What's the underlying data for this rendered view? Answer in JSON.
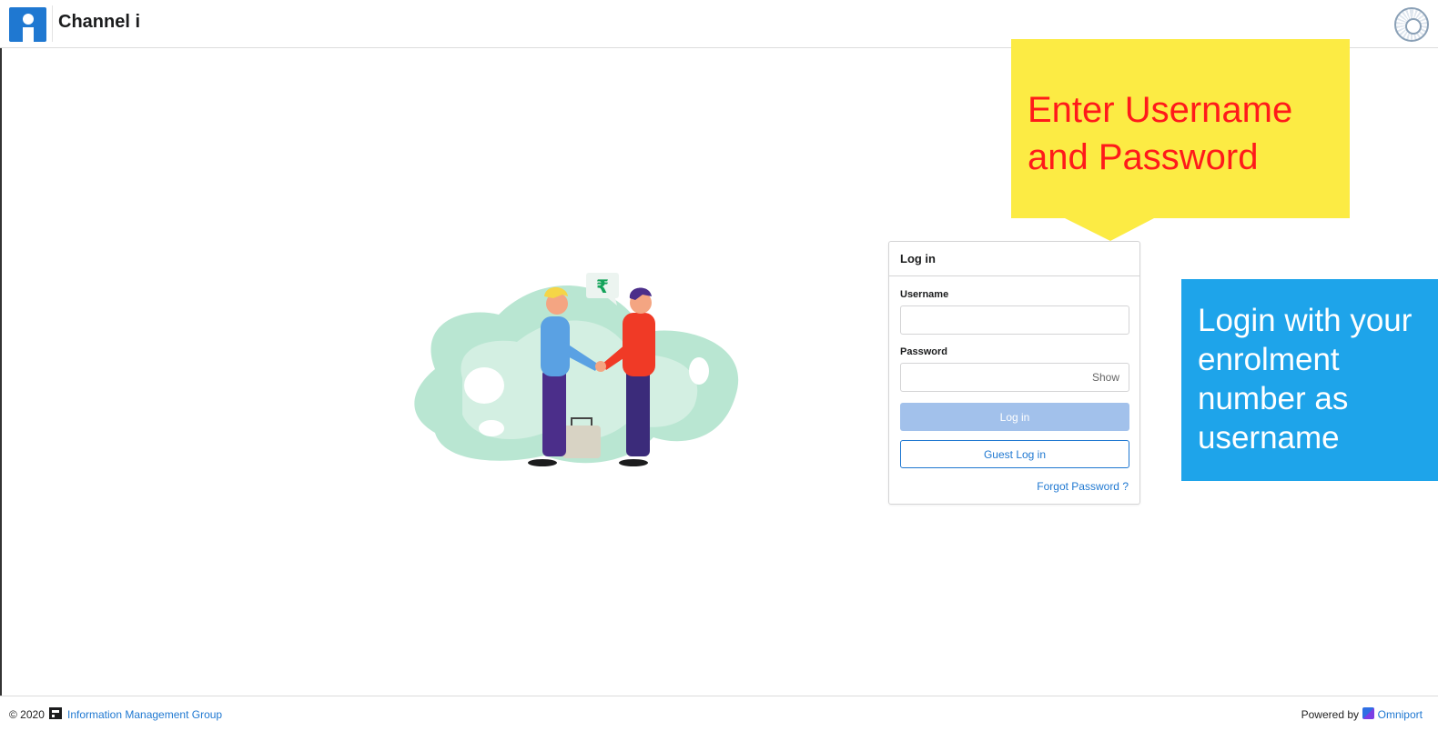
{
  "header": {
    "app_title": "Channel i",
    "app_logo_icon": "channel-i-logo-icon",
    "seal_icon": "institute-seal-icon"
  },
  "login": {
    "card_title": "Log in",
    "username_label": "Username",
    "username_value": "",
    "password_label": "Password",
    "password_value": "",
    "show_label": "Show",
    "login_button": "Log in",
    "guest_button": "Guest Log in",
    "forgot_link": "Forgot Password ?"
  },
  "callouts": {
    "yellow_line1": "Enter Username",
    "yellow_line2": "and Password",
    "blue_line1": "Login with your",
    "blue_line2": "enrolment",
    "blue_line3": "number as",
    "blue_line4": "username"
  },
  "illustration": {
    "currency_symbol": "₹",
    "icon": "handshake-illustration"
  },
  "footer": {
    "copyright": "© 2020",
    "org_link": "Information Management Group",
    "powered_by": "Powered by",
    "platform_link": "Omniport"
  },
  "colors": {
    "accent": "#1f78d1",
    "login_button_disabled": "#a2c1eb",
    "yellow_callout": "#fceb44",
    "yellow_text": "#ff1a1a",
    "blue_callout": "#1ea4ea",
    "blob": "#b9e6d2"
  }
}
